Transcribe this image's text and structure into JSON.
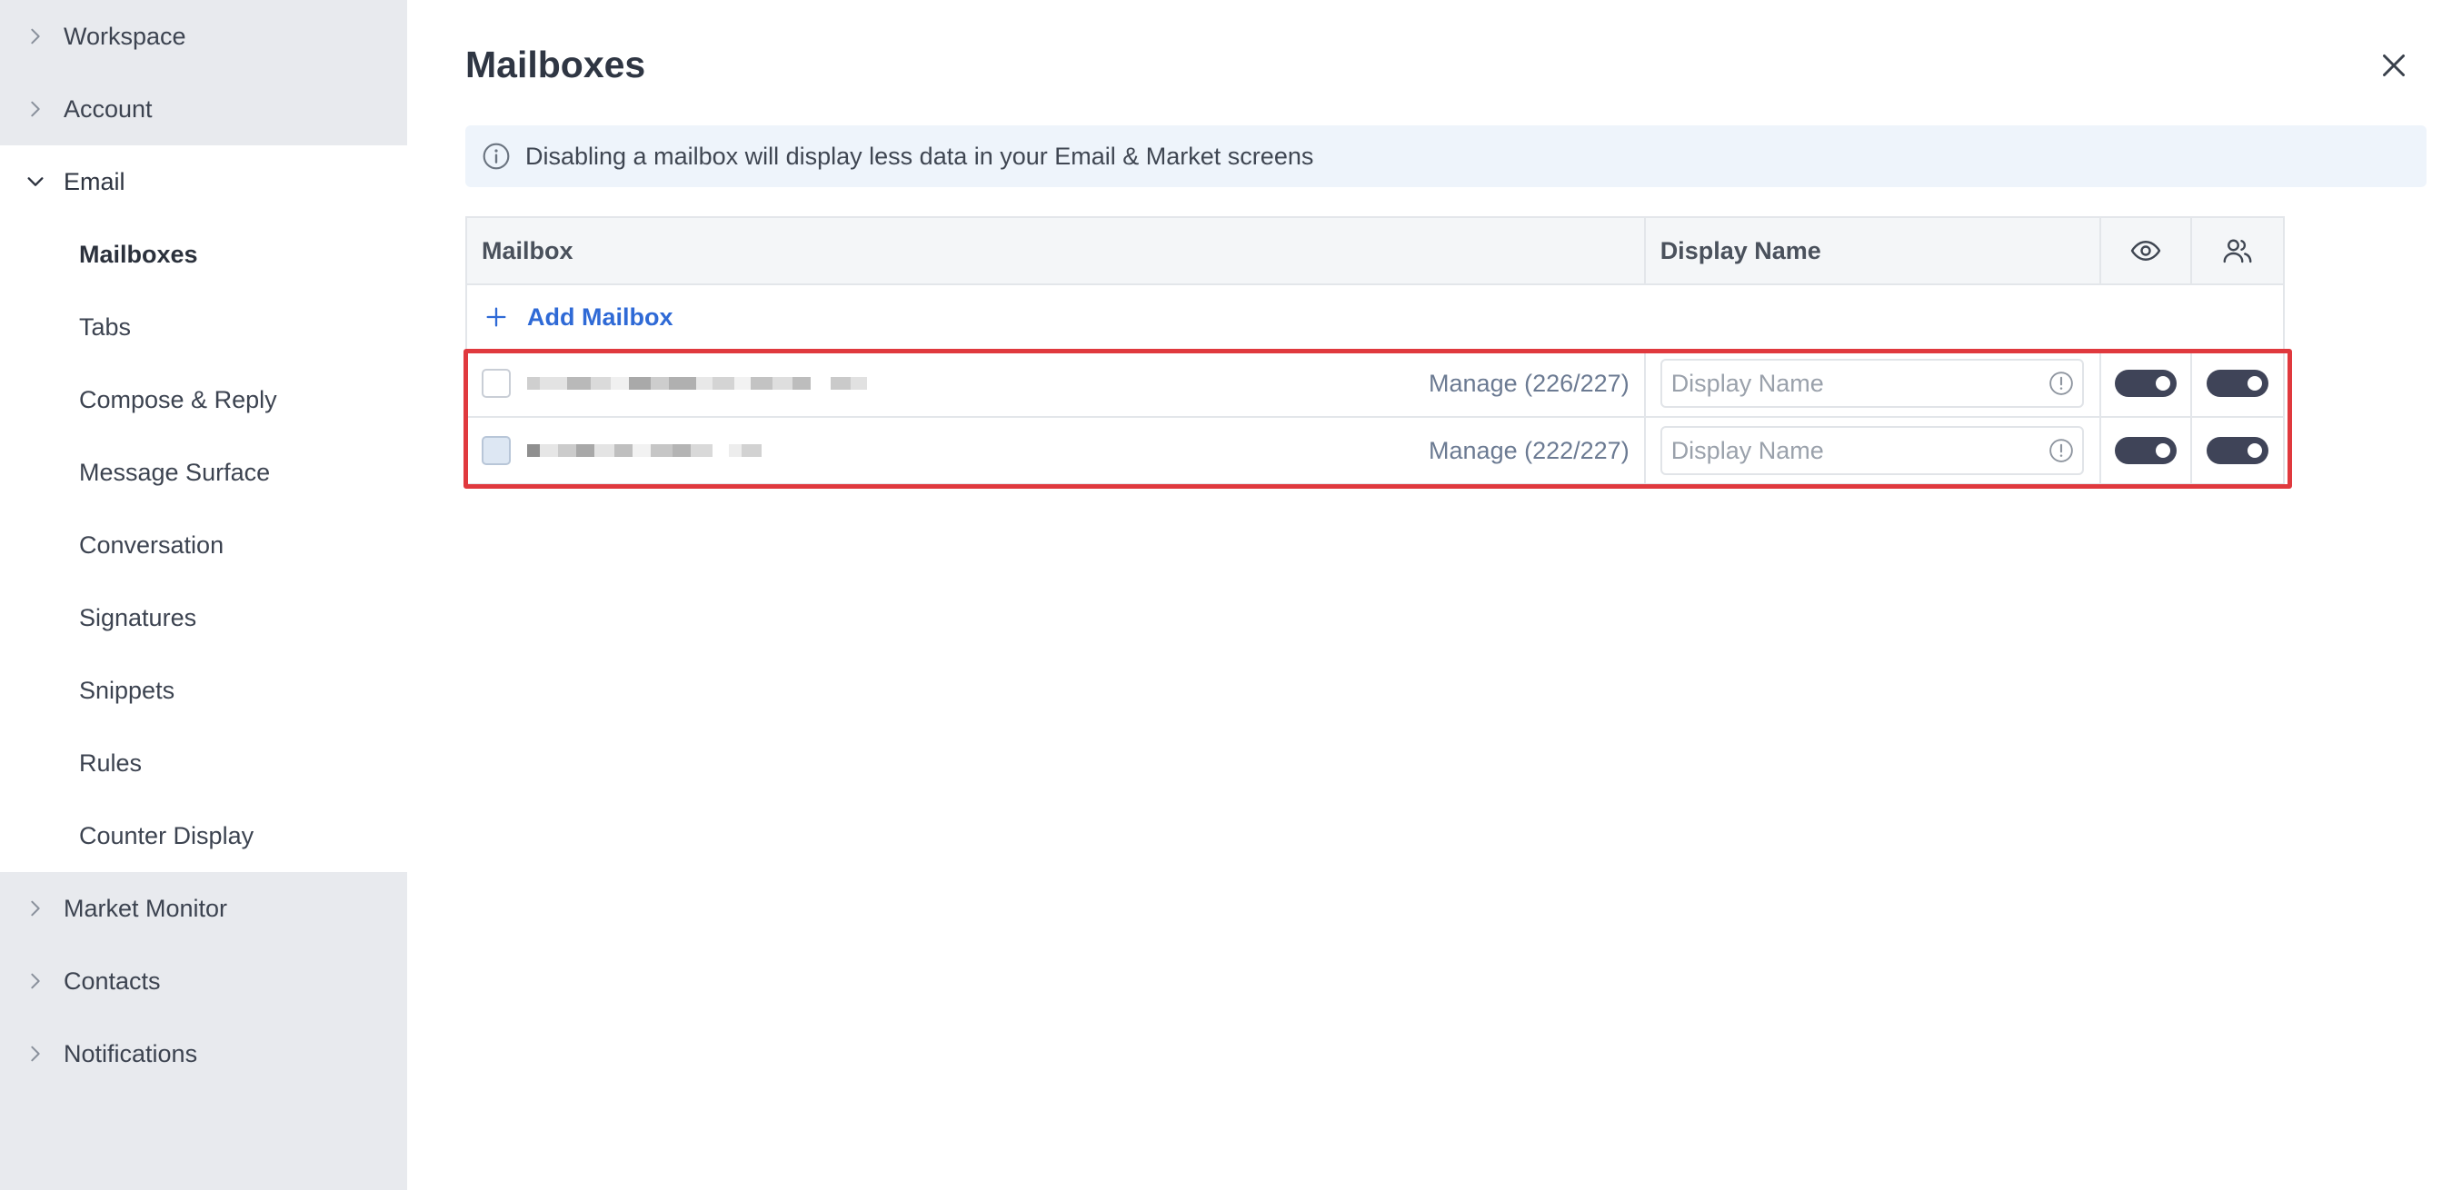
{
  "sidebar": {
    "groups_top": [
      {
        "label": "Workspace",
        "icon": "chevron-right-icon"
      },
      {
        "label": "Account",
        "icon": "chevron-right-icon"
      }
    ],
    "email": {
      "label": "Email",
      "icon": "chevron-down-icon",
      "items": [
        {
          "label": "Mailboxes",
          "active": true
        },
        {
          "label": "Tabs"
        },
        {
          "label": "Compose & Reply"
        },
        {
          "label": "Message Surface"
        },
        {
          "label": "Conversation"
        },
        {
          "label": "Signatures"
        },
        {
          "label": "Snippets"
        },
        {
          "label": "Rules"
        },
        {
          "label": "Counter Display"
        }
      ]
    },
    "groups_bottom": [
      {
        "label": "Market Monitor",
        "icon": "chevron-right-icon"
      },
      {
        "label": "Contacts",
        "icon": "chevron-right-icon"
      },
      {
        "label": "Notifications",
        "icon": "chevron-right-icon"
      }
    ]
  },
  "main": {
    "title": "Mailboxes",
    "info_text": "Disabling a mailbox will display less data in your Email & Market screens",
    "table": {
      "headers": {
        "mailbox": "Mailbox",
        "display_name": "Display Name",
        "visible_icon": "eye-icon",
        "shared_icon": "users-icon"
      },
      "add_label": "Add Mailbox",
      "rows": [
        {
          "manage": "Manage (226/227)",
          "display_placeholder": "Display Name",
          "visible": true,
          "shared": true
        },
        {
          "manage": "Manage (222/227)",
          "display_placeholder": "Display Name",
          "visible": true,
          "shared": true
        }
      ]
    }
  },
  "colors": {
    "accent": "#2f6ad6",
    "highlight": "#e0393e",
    "toggle_on": "#3f4458",
    "sidebar_bg": "#e8eaee",
    "banner_bg": "#eef4fb"
  }
}
